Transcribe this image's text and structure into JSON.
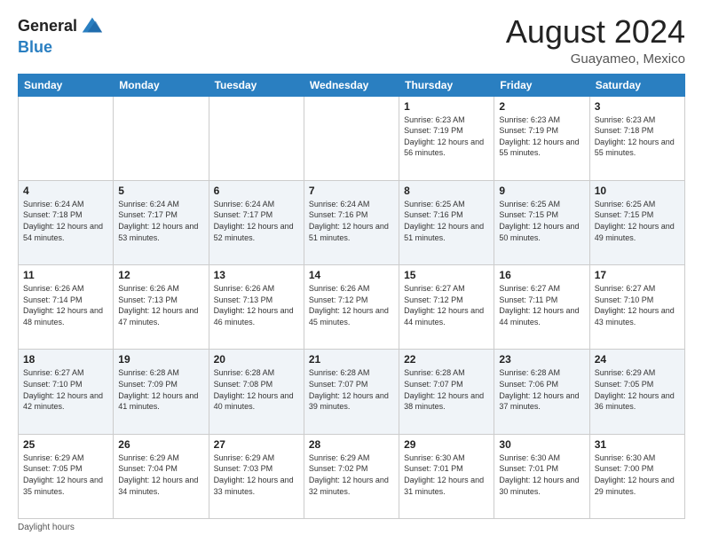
{
  "logo": {
    "line1": "General",
    "line2": "Blue"
  },
  "header": {
    "month": "August 2024",
    "location": "Guayameo, Mexico"
  },
  "weekdays": [
    "Sunday",
    "Monday",
    "Tuesday",
    "Wednesday",
    "Thursday",
    "Friday",
    "Saturday"
  ],
  "footer": {
    "note": "Daylight hours"
  },
  "weeks": [
    [
      {
        "day": "",
        "sunrise": "",
        "sunset": "",
        "daylight": ""
      },
      {
        "day": "",
        "sunrise": "",
        "sunset": "",
        "daylight": ""
      },
      {
        "day": "",
        "sunrise": "",
        "sunset": "",
        "daylight": ""
      },
      {
        "day": "",
        "sunrise": "",
        "sunset": "",
        "daylight": ""
      },
      {
        "day": "1",
        "sunrise": "Sunrise: 6:23 AM",
        "sunset": "Sunset: 7:19 PM",
        "daylight": "Daylight: 12 hours and 56 minutes."
      },
      {
        "day": "2",
        "sunrise": "Sunrise: 6:23 AM",
        "sunset": "Sunset: 7:19 PM",
        "daylight": "Daylight: 12 hours and 55 minutes."
      },
      {
        "day": "3",
        "sunrise": "Sunrise: 6:23 AM",
        "sunset": "Sunset: 7:18 PM",
        "daylight": "Daylight: 12 hours and 55 minutes."
      }
    ],
    [
      {
        "day": "4",
        "sunrise": "Sunrise: 6:24 AM",
        "sunset": "Sunset: 7:18 PM",
        "daylight": "Daylight: 12 hours and 54 minutes."
      },
      {
        "day": "5",
        "sunrise": "Sunrise: 6:24 AM",
        "sunset": "Sunset: 7:17 PM",
        "daylight": "Daylight: 12 hours and 53 minutes."
      },
      {
        "day": "6",
        "sunrise": "Sunrise: 6:24 AM",
        "sunset": "Sunset: 7:17 PM",
        "daylight": "Daylight: 12 hours and 52 minutes."
      },
      {
        "day": "7",
        "sunrise": "Sunrise: 6:24 AM",
        "sunset": "Sunset: 7:16 PM",
        "daylight": "Daylight: 12 hours and 51 minutes."
      },
      {
        "day": "8",
        "sunrise": "Sunrise: 6:25 AM",
        "sunset": "Sunset: 7:16 PM",
        "daylight": "Daylight: 12 hours and 51 minutes."
      },
      {
        "day": "9",
        "sunrise": "Sunrise: 6:25 AM",
        "sunset": "Sunset: 7:15 PM",
        "daylight": "Daylight: 12 hours and 50 minutes."
      },
      {
        "day": "10",
        "sunrise": "Sunrise: 6:25 AM",
        "sunset": "Sunset: 7:15 PM",
        "daylight": "Daylight: 12 hours and 49 minutes."
      }
    ],
    [
      {
        "day": "11",
        "sunrise": "Sunrise: 6:26 AM",
        "sunset": "Sunset: 7:14 PM",
        "daylight": "Daylight: 12 hours and 48 minutes."
      },
      {
        "day": "12",
        "sunrise": "Sunrise: 6:26 AM",
        "sunset": "Sunset: 7:13 PM",
        "daylight": "Daylight: 12 hours and 47 minutes."
      },
      {
        "day": "13",
        "sunrise": "Sunrise: 6:26 AM",
        "sunset": "Sunset: 7:13 PM",
        "daylight": "Daylight: 12 hours and 46 minutes."
      },
      {
        "day": "14",
        "sunrise": "Sunrise: 6:26 AM",
        "sunset": "Sunset: 7:12 PM",
        "daylight": "Daylight: 12 hours and 45 minutes."
      },
      {
        "day": "15",
        "sunrise": "Sunrise: 6:27 AM",
        "sunset": "Sunset: 7:12 PM",
        "daylight": "Daylight: 12 hours and 44 minutes."
      },
      {
        "day": "16",
        "sunrise": "Sunrise: 6:27 AM",
        "sunset": "Sunset: 7:11 PM",
        "daylight": "Daylight: 12 hours and 44 minutes."
      },
      {
        "day": "17",
        "sunrise": "Sunrise: 6:27 AM",
        "sunset": "Sunset: 7:10 PM",
        "daylight": "Daylight: 12 hours and 43 minutes."
      }
    ],
    [
      {
        "day": "18",
        "sunrise": "Sunrise: 6:27 AM",
        "sunset": "Sunset: 7:10 PM",
        "daylight": "Daylight: 12 hours and 42 minutes."
      },
      {
        "day": "19",
        "sunrise": "Sunrise: 6:28 AM",
        "sunset": "Sunset: 7:09 PM",
        "daylight": "Daylight: 12 hours and 41 minutes."
      },
      {
        "day": "20",
        "sunrise": "Sunrise: 6:28 AM",
        "sunset": "Sunset: 7:08 PM",
        "daylight": "Daylight: 12 hours and 40 minutes."
      },
      {
        "day": "21",
        "sunrise": "Sunrise: 6:28 AM",
        "sunset": "Sunset: 7:07 PM",
        "daylight": "Daylight: 12 hours and 39 minutes."
      },
      {
        "day": "22",
        "sunrise": "Sunrise: 6:28 AM",
        "sunset": "Sunset: 7:07 PM",
        "daylight": "Daylight: 12 hours and 38 minutes."
      },
      {
        "day": "23",
        "sunrise": "Sunrise: 6:28 AM",
        "sunset": "Sunset: 7:06 PM",
        "daylight": "Daylight: 12 hours and 37 minutes."
      },
      {
        "day": "24",
        "sunrise": "Sunrise: 6:29 AM",
        "sunset": "Sunset: 7:05 PM",
        "daylight": "Daylight: 12 hours and 36 minutes."
      }
    ],
    [
      {
        "day": "25",
        "sunrise": "Sunrise: 6:29 AM",
        "sunset": "Sunset: 7:05 PM",
        "daylight": "Daylight: 12 hours and 35 minutes."
      },
      {
        "day": "26",
        "sunrise": "Sunrise: 6:29 AM",
        "sunset": "Sunset: 7:04 PM",
        "daylight": "Daylight: 12 hours and 34 minutes."
      },
      {
        "day": "27",
        "sunrise": "Sunrise: 6:29 AM",
        "sunset": "Sunset: 7:03 PM",
        "daylight": "Daylight: 12 hours and 33 minutes."
      },
      {
        "day": "28",
        "sunrise": "Sunrise: 6:29 AM",
        "sunset": "Sunset: 7:02 PM",
        "daylight": "Daylight: 12 hours and 32 minutes."
      },
      {
        "day": "29",
        "sunrise": "Sunrise: 6:30 AM",
        "sunset": "Sunset: 7:01 PM",
        "daylight": "Daylight: 12 hours and 31 minutes."
      },
      {
        "day": "30",
        "sunrise": "Sunrise: 6:30 AM",
        "sunset": "Sunset: 7:01 PM",
        "daylight": "Daylight: 12 hours and 30 minutes."
      },
      {
        "day": "31",
        "sunrise": "Sunrise: 6:30 AM",
        "sunset": "Sunset: 7:00 PM",
        "daylight": "Daylight: 12 hours and 29 minutes."
      }
    ]
  ]
}
